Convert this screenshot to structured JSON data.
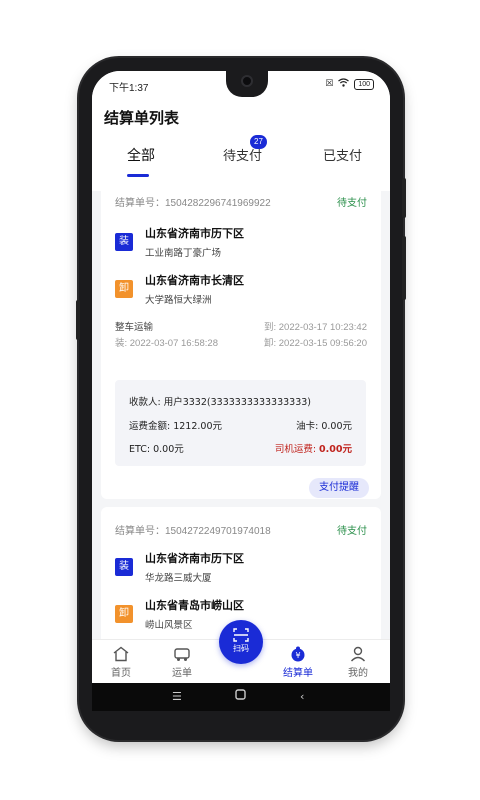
{
  "status_bar": {
    "time": "下午1:37",
    "battery": "100"
  },
  "header": {
    "title": "结算单列表",
    "tabs": [
      {
        "label": "全部",
        "active": true
      },
      {
        "label": "待支付",
        "badge": "27"
      },
      {
        "label": "已支付"
      }
    ]
  },
  "orders": [
    {
      "number_label": "结算单号：1504282296741969922",
      "status": "待支付",
      "load": {
        "tag": "装",
        "city": "山东省济南市历下区",
        "address": "工业南路丁豪广场"
      },
      "unload": {
        "tag": "卸",
        "city": "山东省济南市长清区",
        "address": "大学路恒大绿洲"
      },
      "vehicle": "整车运输",
      "load_time": "装: 2022-03-07 16:58:28",
      "unload_time": "卸: 2022-03-15 09:56:20",
      "arrive_time": "到: 2022-03-17 10:23:42",
      "payee": "收款人: 用户3332(3333333333333333)",
      "freight": "运费金额: 1212.00元",
      "oil_card": "油卡: 0.00元",
      "etc": "ETC: 0.00元",
      "driver_fee_label": "司机运费: ",
      "driver_fee_value": "0.00元",
      "remind_label": "支付提醒"
    },
    {
      "number_label": "结算单号：1504272249701974018",
      "status": "待支付",
      "load": {
        "tag": "装",
        "city": "山东省济南市历下区",
        "address": "华龙路三威大厦"
      },
      "unload": {
        "tag": "卸",
        "city": "山东省青岛市崂山区",
        "address": "崂山风景区"
      }
    }
  ],
  "bottom_nav": {
    "items": [
      {
        "label": "首页",
        "icon": "home-icon"
      },
      {
        "label": "运单",
        "icon": "truck-icon"
      },
      {
        "label": "结算单",
        "icon": "settlement-icon",
        "active": true
      },
      {
        "label": "我的",
        "icon": "user-icon"
      }
    ],
    "scan_label": "扫码"
  },
  "colors": {
    "accent": "#1a2bd6",
    "status_green": "#2a8f4a",
    "unload_orange": "#f2922c",
    "fee_red": "#c0231d"
  }
}
